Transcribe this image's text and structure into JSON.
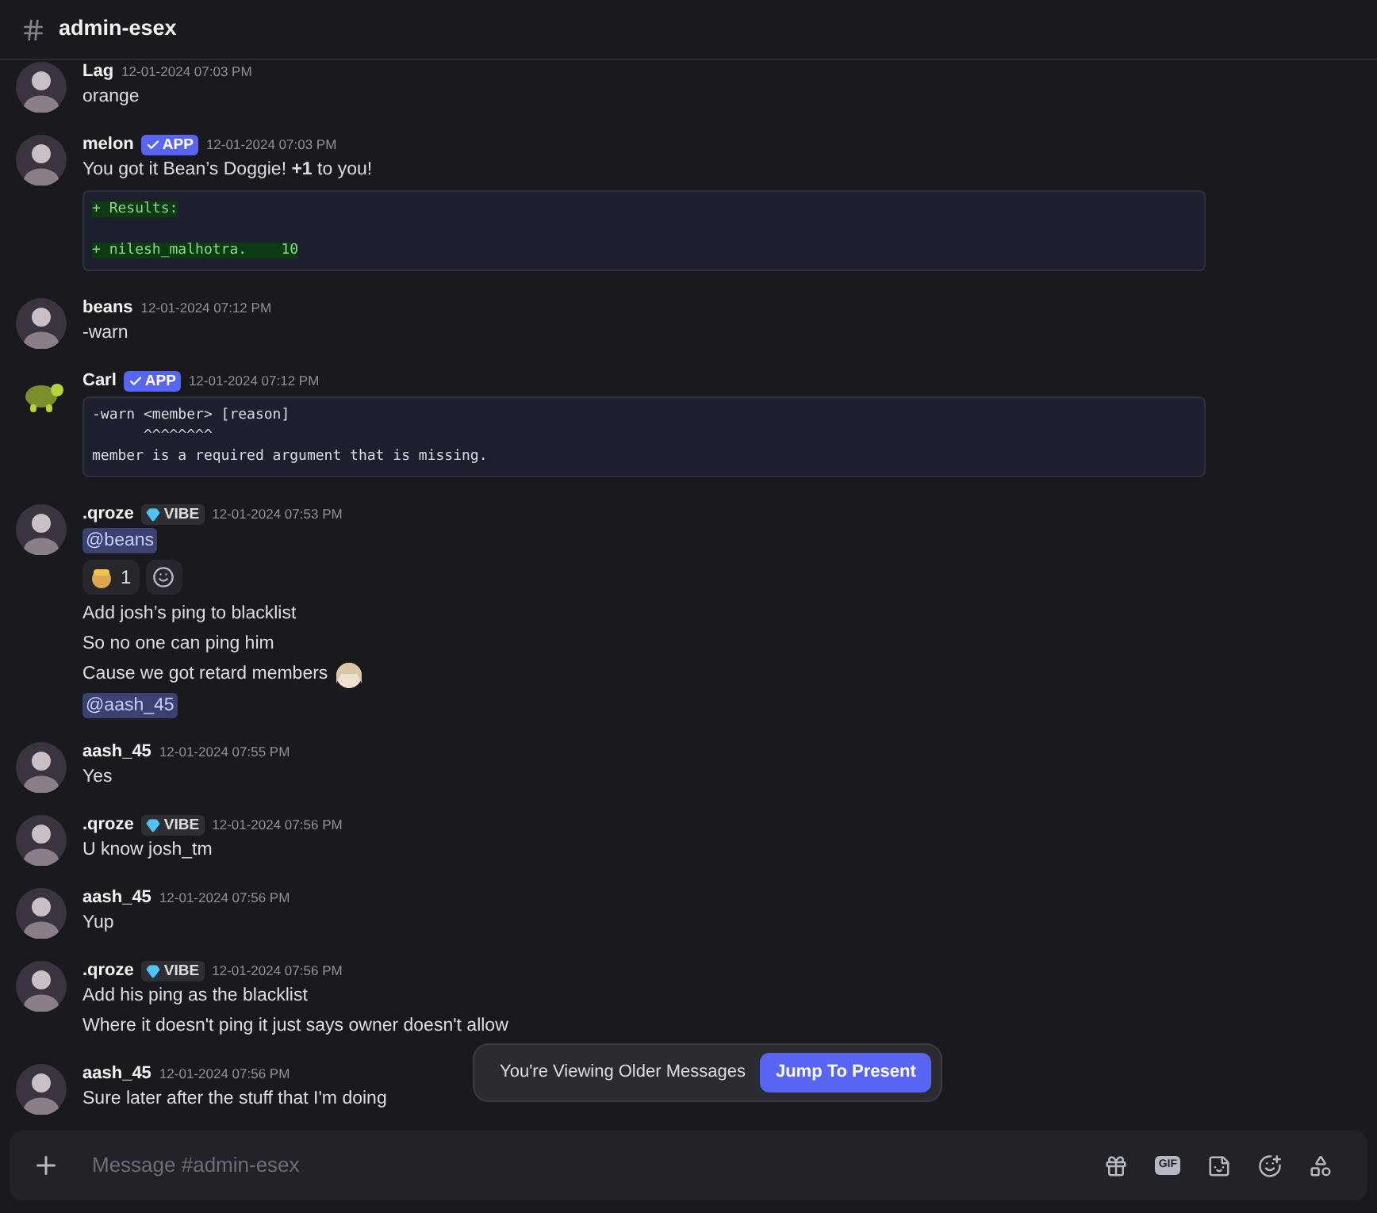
{
  "channel": {
    "name": "admin-esex"
  },
  "messages": [
    {
      "author": "Lag",
      "avatar": {
        "kind": "person"
      },
      "time": "12-01-2024 07:03 PM",
      "blocks": [
        {
          "kind": "text",
          "text": "orange"
        }
      ]
    },
    {
      "author": "melon",
      "avatar": {
        "kind": "person"
      },
      "badge": {
        "kind": "app",
        "label": "APP"
      },
      "time": "12-01-2024 07:03 PM",
      "blocks": [
        {
          "kind": "text",
          "text": "You got it Bean’s Doggie! **+1** to you!"
        },
        {
          "kind": "code",
          "lines": [
            {
              "kind": "added",
              "text": "+ Results:"
            },
            {
              "kind": "blank"
            },
            {
              "kind": "added",
              "text": "+ nilesh_malhotra.    10"
            }
          ]
        }
      ]
    },
    {
      "author": "beans",
      "avatar": {
        "kind": "person"
      },
      "time": "12-01-2024 07:12 PM",
      "blocks": [
        {
          "kind": "text",
          "text": "-warn"
        }
      ]
    },
    {
      "author": "Carl",
      "avatar": {
        "kind": "turtle"
      },
      "badge": {
        "kind": "app",
        "label": "APP"
      },
      "time": "12-01-2024 07:12 PM",
      "blocks": [
        {
          "kind": "code",
          "lines": [
            {
              "kind": "plain",
              "text": "-warn <member> [reason]"
            },
            {
              "kind": "plain",
              "text": "      ^^^^^^^^"
            },
            {
              "kind": "plain",
              "text": "member is a required argument that is missing."
            }
          ]
        }
      ]
    },
    {
      "author": ".qroze",
      "avatar": {
        "kind": "person"
      },
      "badge": {
        "kind": "vibe",
        "label": "VIBE"
      },
      "time": "12-01-2024 07:53 PM",
      "blocks": [
        {
          "kind": "mention",
          "text": "@beans"
        },
        {
          "kind": "reactions",
          "items": [
            {
              "count": "1",
              "selected": false
            }
          ]
        },
        {
          "kind": "text",
          "text": "Add josh’s ping to blacklist"
        },
        {
          "kind": "text",
          "text": "So no one can ping him"
        },
        {
          "kind": "text",
          "text": "Cause we got retard members",
          "emoji": true
        },
        {
          "kind": "mention",
          "text": "@aash_45"
        }
      ]
    },
    {
      "author": "aash_45",
      "avatar": {
        "kind": "person"
      },
      "time": "12-01-2024 07:55 PM",
      "blocks": [
        {
          "kind": "text",
          "text": "Yes"
        }
      ]
    },
    {
      "author": ".qroze",
      "avatar": {
        "kind": "person"
      },
      "badge": {
        "kind": "vibe",
        "label": "VIBE"
      },
      "time": "12-01-2024 07:56 PM",
      "blocks": [
        {
          "kind": "text",
          "text": "U know josh_tm"
        }
      ]
    },
    {
      "author": "aash_45",
      "avatar": {
        "kind": "person"
      },
      "time": "12-01-2024 07:56 PM",
      "blocks": [
        {
          "kind": "text",
          "text": "Yup"
        }
      ]
    },
    {
      "author": ".qroze",
      "avatar": {
        "kind": "person"
      },
      "badge": {
        "kind": "vibe",
        "label": "VIBE"
      },
      "time": "12-01-2024 07:56 PM",
      "blocks": [
        {
          "kind": "text",
          "text": "Add his ping as the blacklist"
        },
        {
          "kind": "text",
          "text": "Where it doesn't ping it just says owner doesn't allow"
        }
      ]
    },
    {
      "author": "aash_45",
      "avatar": {
        "kind": "person"
      },
      "time": "12-01-2024 07:56 PM",
      "blocks": [
        {
          "kind": "text",
          "text": "Sure later after the stuff that I'm doing"
        }
      ]
    }
  ],
  "banner": {
    "text": "You're Viewing Older Messages",
    "button": "Jump To Present"
  },
  "composer": {
    "placeholder": "Message #admin-esex",
    "gif_label": "GIF"
  }
}
